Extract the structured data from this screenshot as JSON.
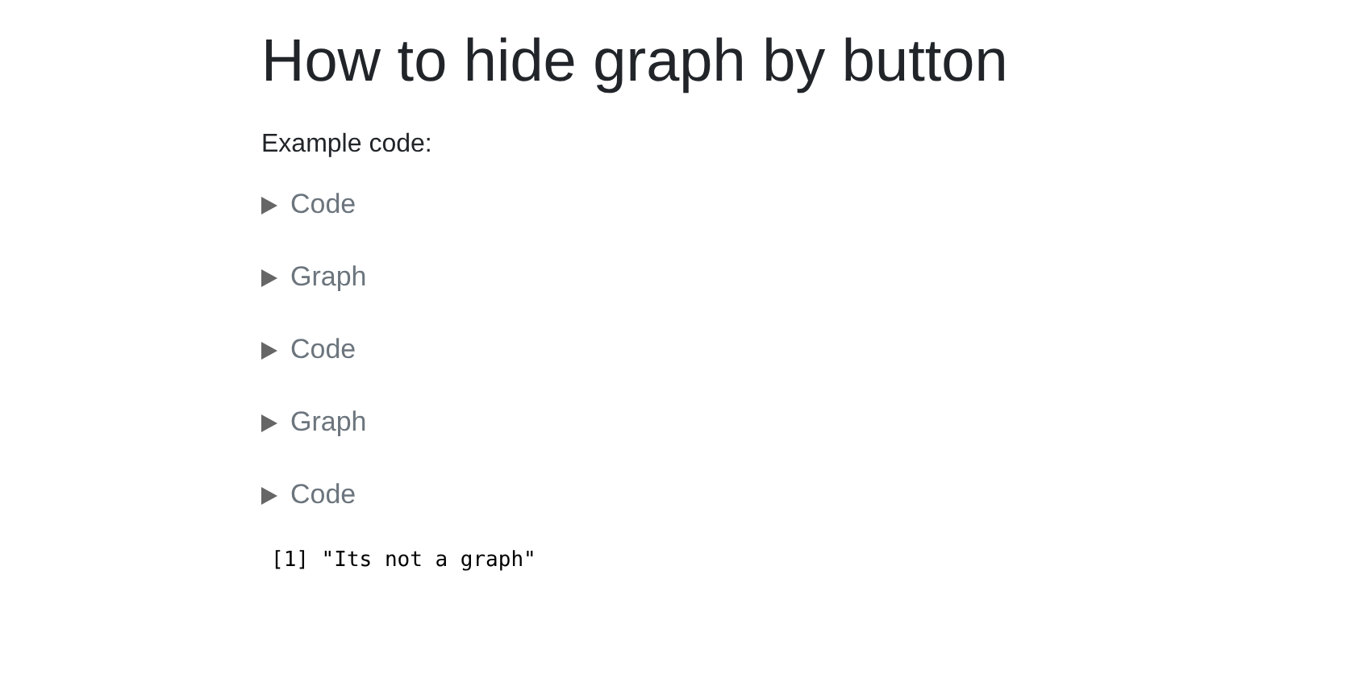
{
  "title": "How to hide graph by button",
  "intro": "Example code:",
  "sections": [
    {
      "label": "Code",
      "expanded": false
    },
    {
      "label": "Graph",
      "expanded": false
    },
    {
      "label": "Code",
      "expanded": false
    },
    {
      "label": "Graph",
      "expanded": false
    },
    {
      "label": "Code",
      "expanded": false
    }
  ],
  "output": "[1] \"Its not a graph\""
}
